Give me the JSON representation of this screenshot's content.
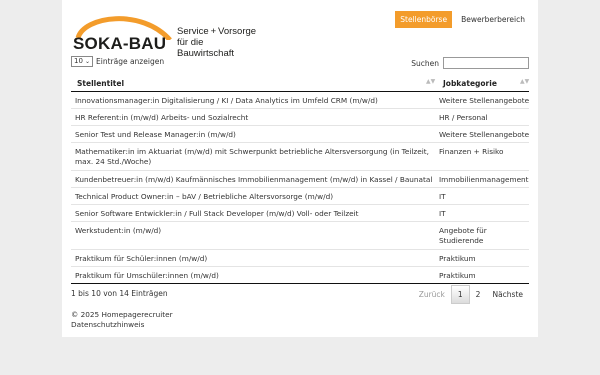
{
  "header": {
    "brand": "SOKA-BAU",
    "tagline_line1": "Service + Vorsorge",
    "tagline_line2": "für die Bauwirtschaft",
    "nav": [
      {
        "label": "Stellenbörse",
        "active": true
      },
      {
        "label": "Bewerberbereich",
        "active": false
      }
    ],
    "accent_color": "#f39c2b"
  },
  "controls": {
    "length_value": "10",
    "length_suffix": "Einträge anzeigen",
    "search_label": "Suchen",
    "search_value": ""
  },
  "table": {
    "columns": [
      "Stellentitel",
      "Jobkategorie"
    ],
    "rows": [
      {
        "title": "Innovationsmanager:in Digitalisierung / KI / Data Analytics im Umfeld CRM (m/w/d)",
        "category": "Weitere Stellenangebote"
      },
      {
        "title": "HR Referent:in (m/w/d) Arbeits- und Sozialrecht",
        "category": "HR / Personal"
      },
      {
        "title": "Senior Test und Release Manager:in (m/w/d)",
        "category": "Weitere Stellenangebote"
      },
      {
        "title": "Mathematiker:in im Aktuariat (m/w/d) mit Schwerpunkt betriebliche Altersversorgung (in Teilzeit, max. 24 Std./Woche)",
        "category": "Finanzen + Risiko"
      },
      {
        "title": "Kundenbetreuer:in (m/w/d) Kaufmännisches Immobilienmanagement (m/w/d) in Kassel / Baunatal",
        "category": "Immobilienmanagement"
      },
      {
        "title": "Technical Product Owner:in – bAV / Betriebliche Altersvorsorge (m/w/d)",
        "category": "IT"
      },
      {
        "title": "Senior Software Entwickler:in / Full Stack Developer (m/w/d) Voll- oder Teilzeit",
        "category": "IT"
      },
      {
        "title": "Werkstudent:in (m/w/d)",
        "category": "Angebote für Studierende"
      },
      {
        "title": "Praktikum für Schüler:innen (m/w/d)",
        "category": "Praktikum"
      },
      {
        "title": "Praktikum für Umschüler:innen (m/w/d)",
        "category": "Praktikum"
      }
    ]
  },
  "footer": {
    "info": "1 bis 10 von 14 Einträgen",
    "prev": "Zurück",
    "pages": [
      "1",
      "2"
    ],
    "next": "Nächste",
    "copyright": "© 2025 Homepagerecruiter",
    "privacy": "Datenschutzhinweis"
  }
}
